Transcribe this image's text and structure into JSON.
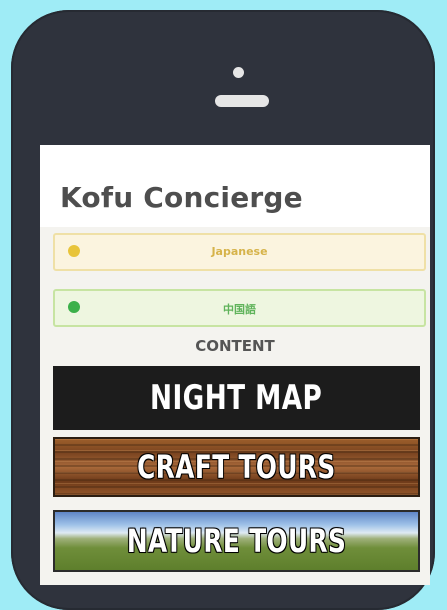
{
  "app": {
    "title": "Kofu Concierge"
  },
  "languages": [
    {
      "label": "Japanese",
      "color": "#e8c43a"
    },
    {
      "label": "中国語",
      "color": "#3cb04a"
    }
  ],
  "section": {
    "label": "CONTENT"
  },
  "banners": [
    {
      "label": "NIGHT MAP"
    },
    {
      "label": "CRAFT TOURS"
    },
    {
      "label": "NATURE TOURS"
    }
  ],
  "colors": {
    "background": "#9fecf6",
    "phone": "#2f333d"
  }
}
